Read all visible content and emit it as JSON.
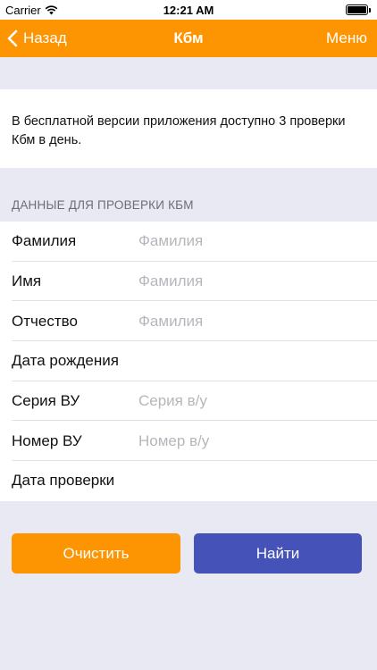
{
  "status_bar": {
    "carrier": "Carrier",
    "time": "12:21 AM"
  },
  "nav": {
    "back_label": "Назад",
    "title": "Кбм",
    "menu_label": "Меню"
  },
  "notice": {
    "text": "В бесплатной версии приложения доступно 3 проверки Кбм в день."
  },
  "form": {
    "section_header": "ДАННЫЕ ДЛЯ ПРОВЕРКИ КБМ",
    "fields": [
      {
        "label": "Фамилия",
        "placeholder": "Фамилия",
        "value": ""
      },
      {
        "label": "Имя",
        "placeholder": "Фамилия",
        "value": ""
      },
      {
        "label": "Отчество",
        "placeholder": "Фамилия",
        "value": ""
      },
      {
        "label": "Дата рождения",
        "placeholder": "",
        "value": ""
      },
      {
        "label": "Серия ВУ",
        "placeholder": "Серия в/у",
        "value": ""
      },
      {
        "label": "Номер ВУ",
        "placeholder": "Номер в/у",
        "value": ""
      },
      {
        "label": "Дата проверки",
        "placeholder": "",
        "value": ""
      }
    ]
  },
  "buttons": {
    "clear_label": "Очистить",
    "find_label": "Найти"
  },
  "colors": {
    "accent_orange": "#fd9402",
    "primary_blue": "#4552b7",
    "background": "#e9e9f3"
  }
}
